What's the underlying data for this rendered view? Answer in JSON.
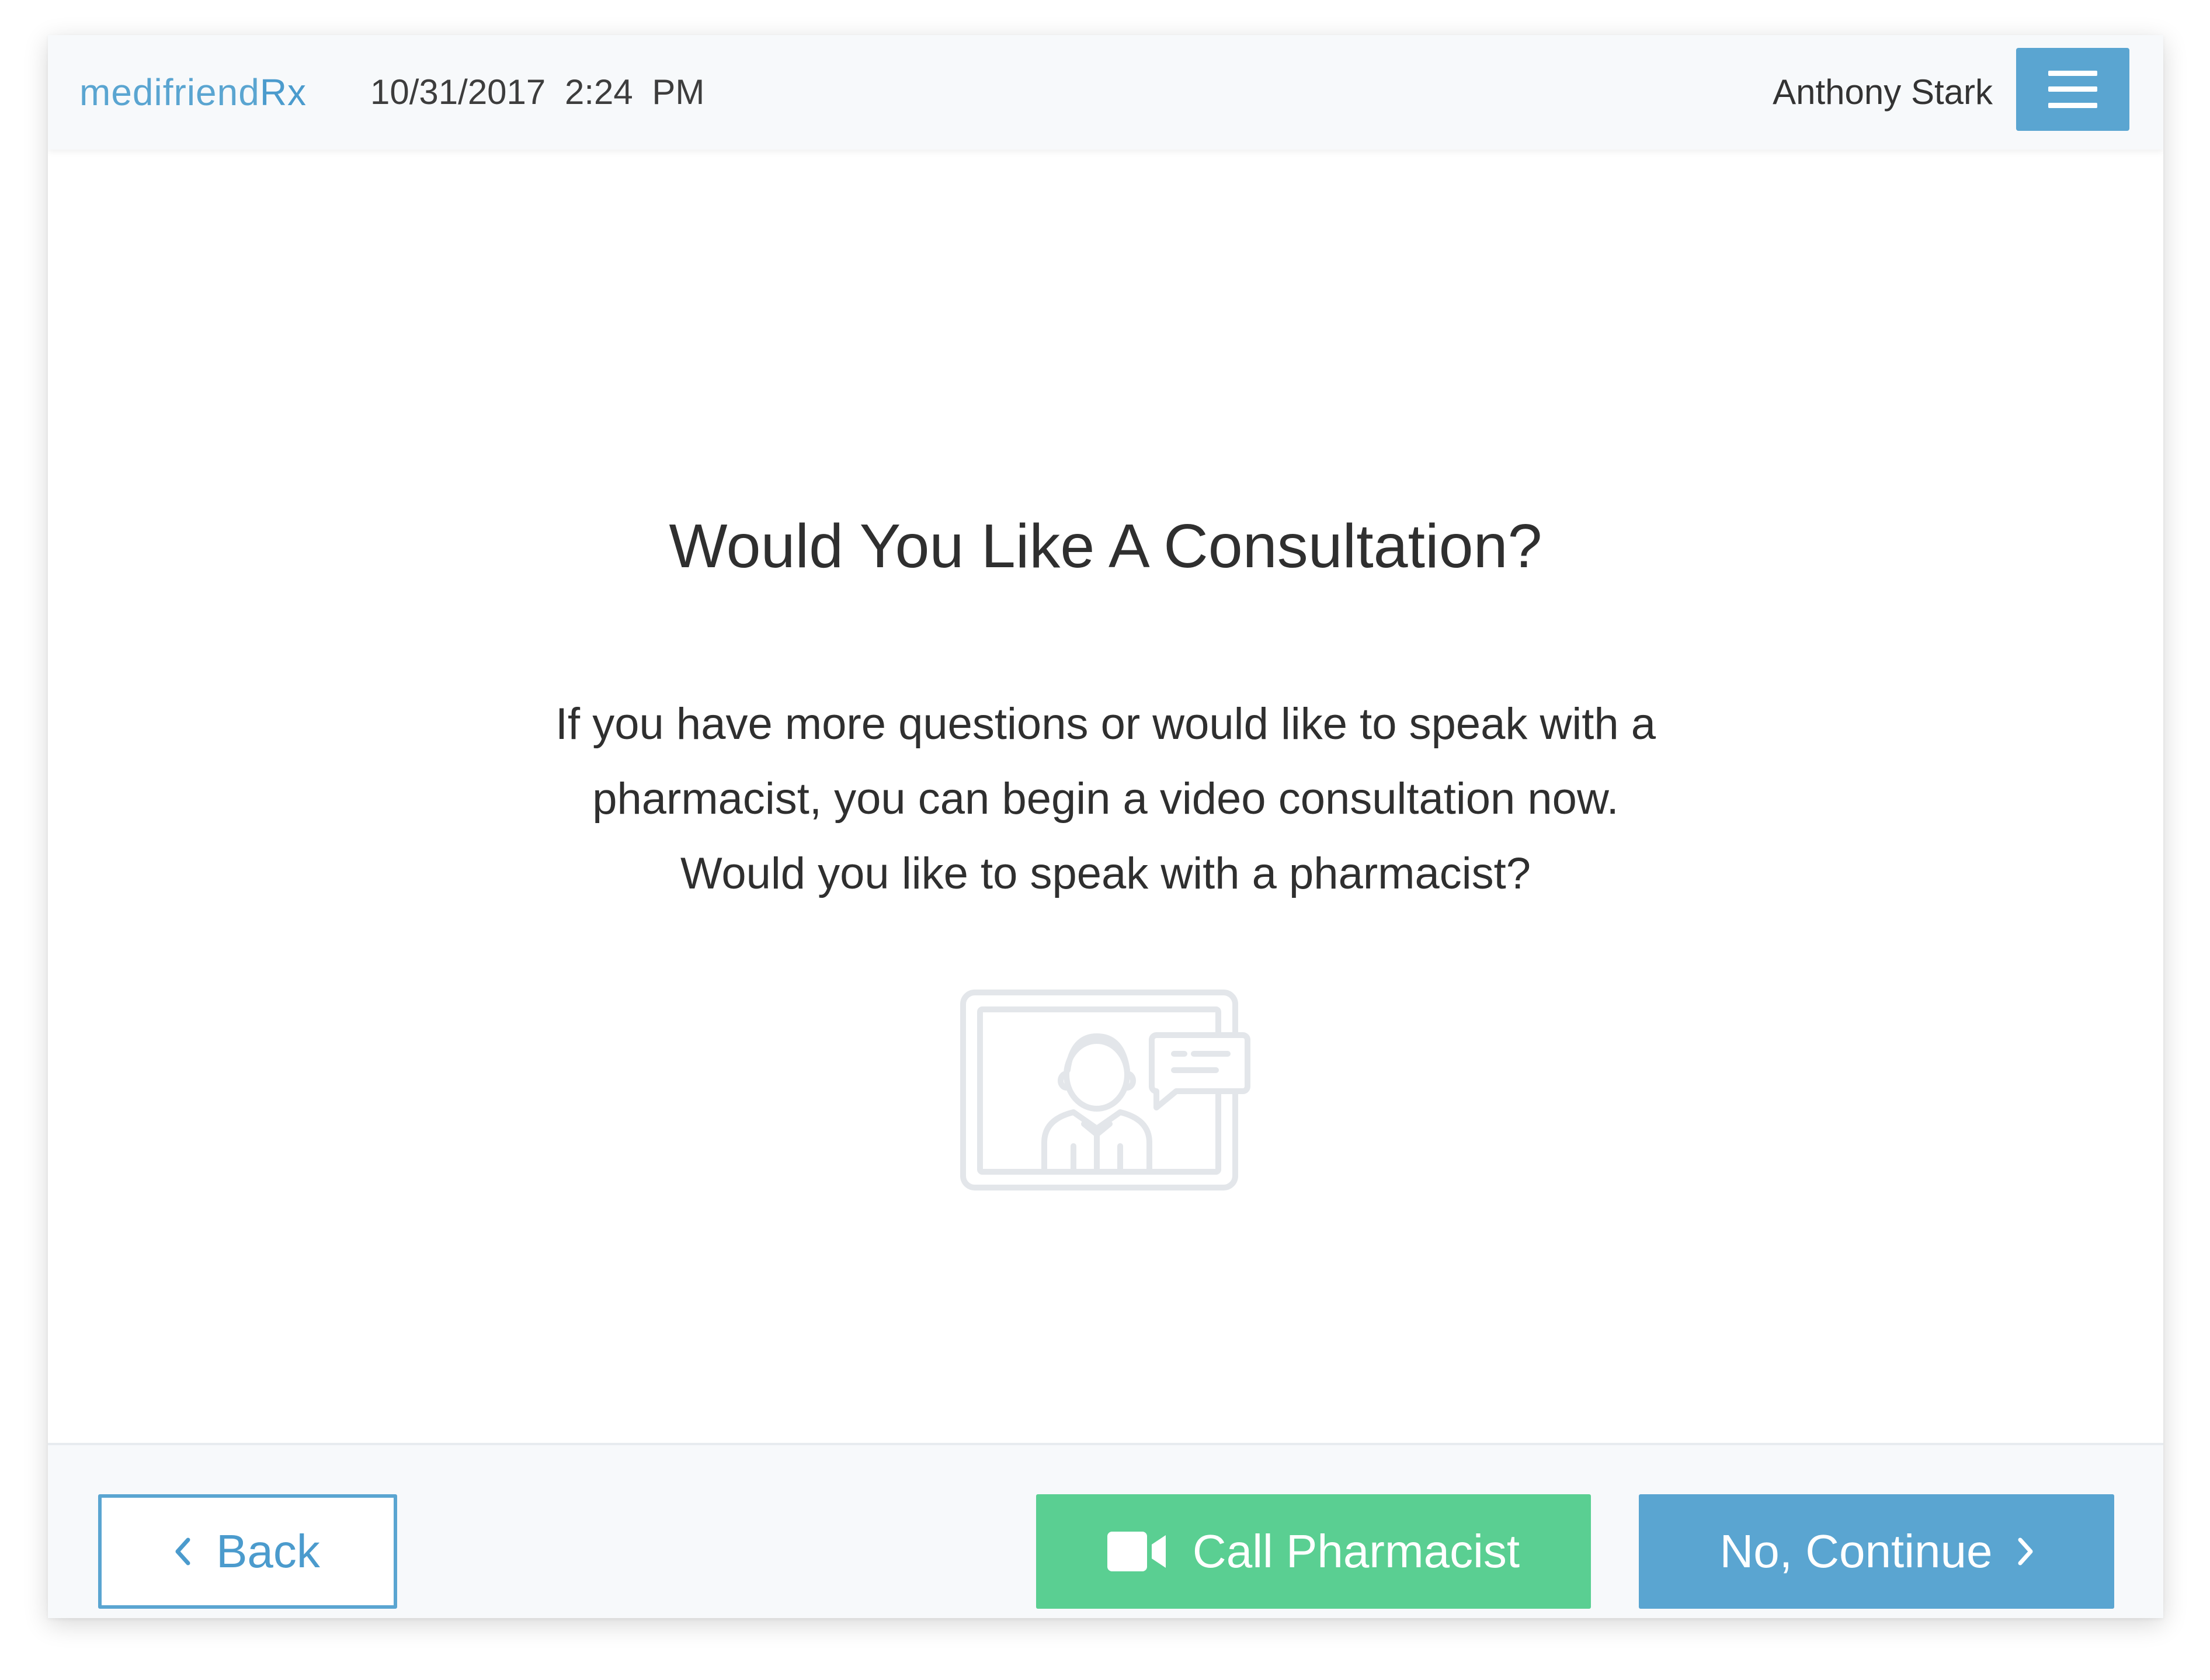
{
  "header": {
    "logo_light": "medifriend",
    "logo_bold": "Rx",
    "datetime": "10/31/2017  2:24 PM",
    "user_name": "Anthony Stark",
    "menu_icon": "hamburger-menu-icon"
  },
  "main": {
    "title": "Would You Like A Consultation?",
    "body": "If you have more questions or would like to speak with a pharmacist, you can begin a video consultation now. Would you like to speak with a pharmacist?",
    "illustration_icon": "video-consultation-pharmacist-icon"
  },
  "footer": {
    "back_label": "Back",
    "back_icon": "chevron-left-icon",
    "call_label": "Call Pharmacist",
    "call_icon": "video-camera-icon",
    "continue_label": "No, Continue",
    "continue_icon": "chevron-right-icon"
  },
  "colors": {
    "accent_blue": "#5aa5d1",
    "call_green": "#5acf92",
    "header_bg": "#f7f9fb",
    "illustration_gray": "#e3e6ea"
  }
}
